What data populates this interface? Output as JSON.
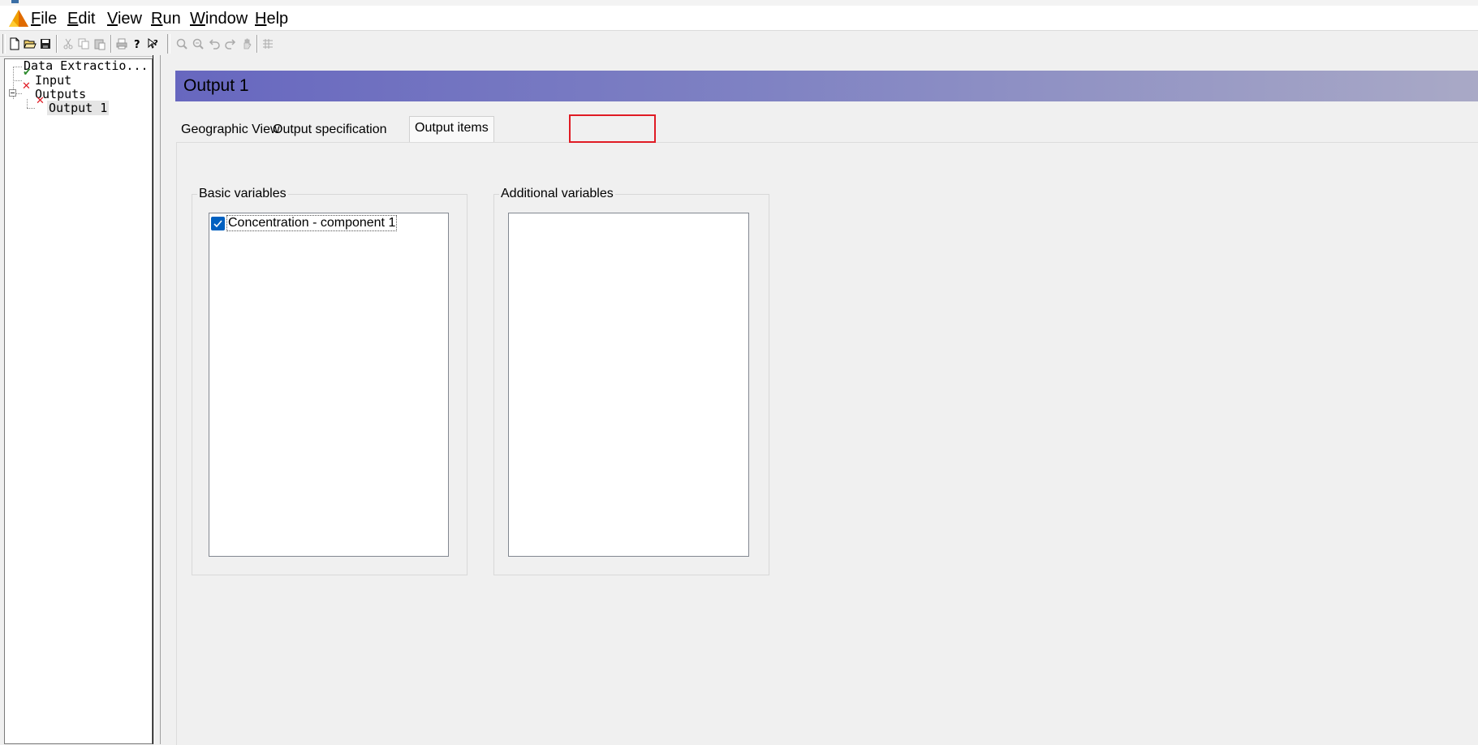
{
  "menu": {
    "items": [
      {
        "key": "F",
        "rest": "ile"
      },
      {
        "key": "E",
        "rest": "dit"
      },
      {
        "key": "V",
        "rest": "iew"
      },
      {
        "key": "R",
        "rest": "un"
      },
      {
        "key": "W",
        "rest": "indow"
      },
      {
        "key": "H",
        "rest": "elp"
      }
    ]
  },
  "toolbar": {
    "icons": [
      "new-file-icon",
      "open-folder-icon",
      "save-icon",
      "cut-icon",
      "copy-icon",
      "paste-icon",
      "print-icon",
      "help-icon",
      "context-help-icon",
      "zoom-in-icon",
      "zoom-out-icon",
      "undo-zoom-icon",
      "redo-zoom-icon",
      "pan-icon",
      "grid-icon"
    ]
  },
  "tree": {
    "root": "Data Extractio...",
    "input": "Input",
    "outputs": "Outputs",
    "output1": "Output 1",
    "status_ok_color": "#2e8b2e",
    "status_error_color": "#e01b24"
  },
  "header": {
    "title": "Output 1"
  },
  "tabs": {
    "geographic": "Geographic View",
    "specification": "Output specification",
    "items": "Output items",
    "active": "Output items"
  },
  "basic_variables": {
    "label": "Basic variables",
    "items": [
      {
        "label": "Concentration - component 1",
        "checked": true
      }
    ]
  },
  "additional_variables": {
    "label": "Additional variables",
    "items": []
  }
}
